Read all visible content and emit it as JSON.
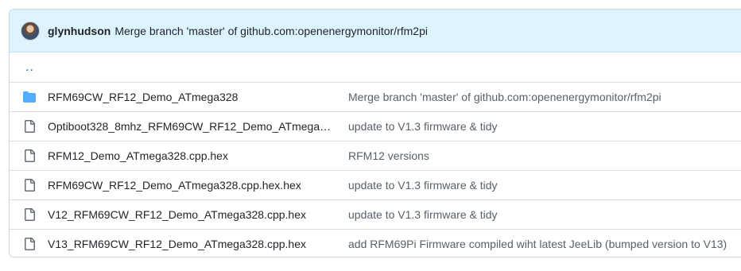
{
  "latest_commit": {
    "author": "glynhudson",
    "message": "Merge branch 'master' of github.com:openenergymonitor/rfm2pi"
  },
  "parent_link": "..",
  "files": [
    {
      "type": "folder",
      "icon": "folder-icon",
      "name": "RFM69CW_RF12_Demo_ATmega328",
      "commit": "Merge branch 'master' of github.com:openenergymonitor/rfm2pi"
    },
    {
      "type": "file",
      "icon": "file-icon",
      "name": "Optiboot328_8mhz_RFM69CW_RF12_Demo_ATmega328....",
      "commit": "update to V1.3 firmware & tidy"
    },
    {
      "type": "file",
      "icon": "file-icon",
      "name": "RFM12_Demo_ATmega328.cpp.hex",
      "commit": "RFM12 versions"
    },
    {
      "type": "file",
      "icon": "file-icon",
      "name": "RFM69CW_RF12_Demo_ATmega328.cpp.hex.hex",
      "commit": "update to V1.3 firmware & tidy"
    },
    {
      "type": "file",
      "icon": "file-icon",
      "name": "V12_RFM69CW_RF12_Demo_ATmega328.cpp.hex",
      "commit": "update to V1.3 firmware & tidy"
    },
    {
      "type": "file",
      "icon": "file-icon",
      "name": "V13_RFM69CW_RF12_Demo_ATmega328.cpp.hex",
      "commit": "add RFM69Pi Firmware compiled wiht latest JeeLib (bumped version to V13)"
    }
  ],
  "colors": {
    "header_bg": "#ddf4ff",
    "folder": "#54aeff",
    "file_icon": "#656d76",
    "link": "#0969da"
  }
}
